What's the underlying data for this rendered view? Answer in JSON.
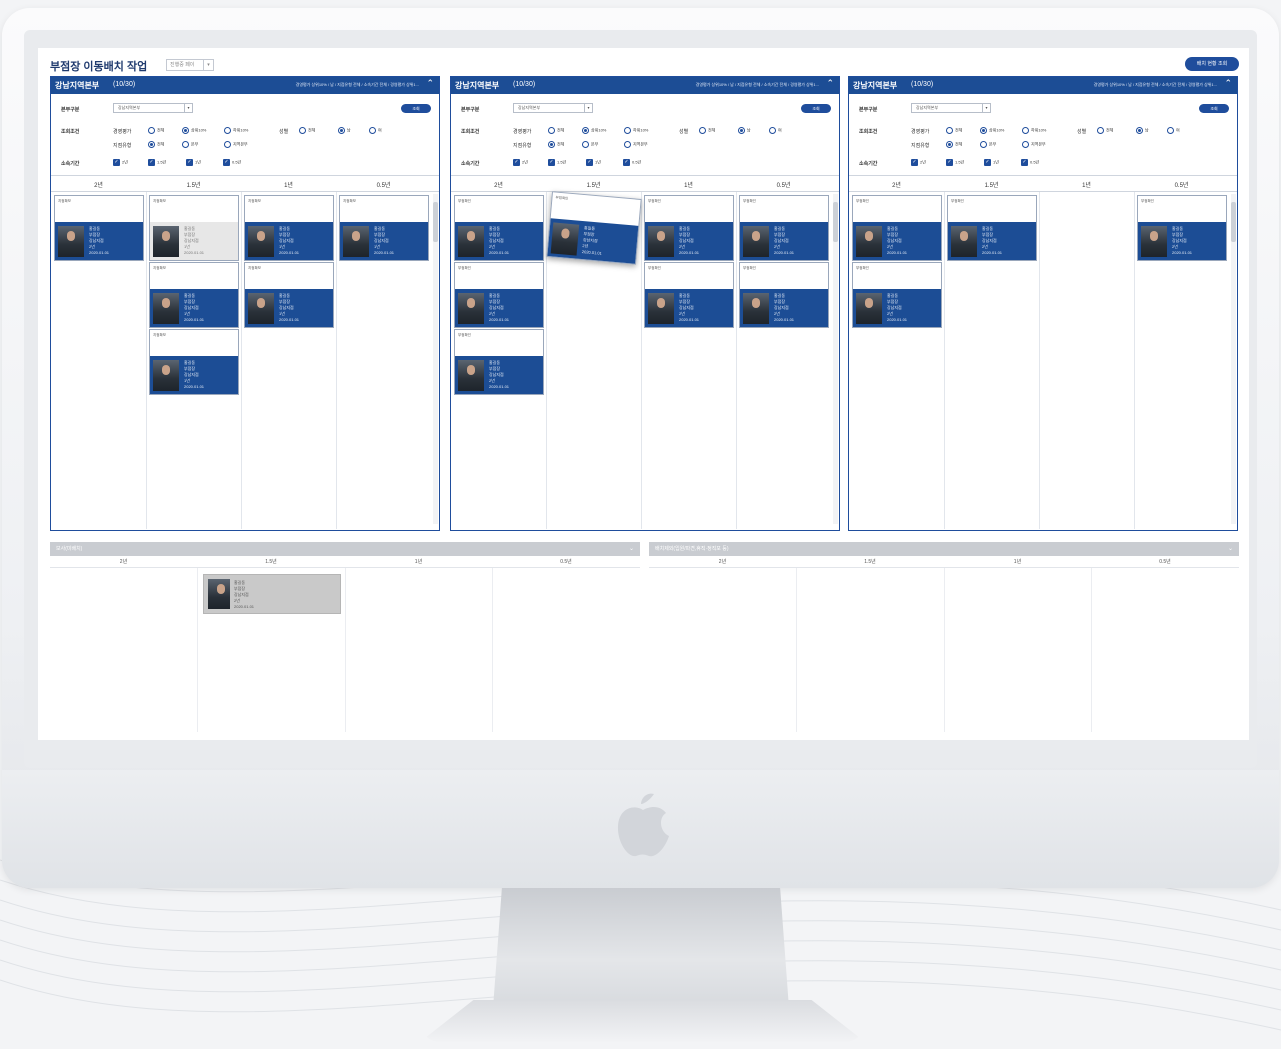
{
  "header": {
    "title": "부점장 이동배치 작업",
    "select_value": "진행중 페이",
    "select_arrow": "▾",
    "top_button": "배치 현황 조회"
  },
  "panels": [
    {
      "name": "강남지역본부",
      "count": "(10/30)",
      "summary": "경영평가 상위10% / 남 / 지점유형 전체 / 소속기간 전체 / 경영평가 상위1...",
      "caret": "⌃",
      "filters": {
        "bonbu_label": "본부구분",
        "bonbu_value": "강남지역본부",
        "search_button": "조회",
        "cond_label": "조회조건",
        "eval_label": "경영평가",
        "eval_options": [
          "전체",
          "상위10%",
          "하위10%"
        ],
        "gender_label": "성별",
        "gender_options": [
          "전체",
          "남",
          "여"
        ],
        "type_label": "지점유형",
        "type_options": [
          "전체",
          "본부",
          "지역본부"
        ],
        "period_label": "소속기간",
        "period_options": [
          "2년",
          "1.5년",
          "1년",
          "0.5년"
        ]
      },
      "columns": [
        "2년",
        "1.5년",
        "1년",
        "0.5년"
      ],
      "cards": [
        {
          "title": "지점확보",
          "name": "홍길동",
          "rank": "부점장",
          "info1": "강남지점",
          "info2": "2년",
          "info3": "2020.01.01"
        },
        {
          "title": "지점확보",
          "name": "홍길동",
          "rank": "부점장",
          "info1": "강남지점",
          "info2": "1년",
          "info3": "2020.01.01"
        },
        {
          "title": "지점확보",
          "name": "홍길동",
          "rank": "부점장",
          "info1": "강남지점",
          "info2": "1년",
          "info3": "2020.01.01"
        },
        {
          "title": "지점확보",
          "name": "홍길동",
          "rank": "부점장",
          "info1": "강남지점",
          "info2": "1년",
          "info3": "2020.01.01"
        },
        {
          "title": "지점확보",
          "name": "홍길동",
          "rank": "부점장",
          "info1": "강남지점",
          "info2": "1년",
          "info3": "2020.01.01"
        },
        {
          "title": "지점확보",
          "name": "홍길동",
          "rank": "부점장",
          "info1": "강남지점",
          "info2": "1년",
          "info3": "2020.01.01"
        },
        {
          "title": "지점확보",
          "name": "홍길동",
          "rank": "부점장",
          "info1": "강남지점",
          "info2": "1년",
          "info3": "2020.01.01"
        }
      ]
    },
    {
      "name": "강남지역본부",
      "count": "(10/30)",
      "summary": "경영평가 상위10% / 남 / 지점유형 전체 / 소속기간 전체 / 경영평가 상위1...",
      "caret": "⌃",
      "filters": {
        "bonbu_label": "본부구분",
        "bonbu_value": "강남지역본부",
        "search_button": "조회",
        "cond_label": "조회조건",
        "eval_label": "경영평가",
        "eval_options": [
          "전체",
          "상위10%",
          "하위10%"
        ],
        "gender_label": "성별",
        "gender_options": [
          "전체",
          "남",
          "여"
        ],
        "type_label": "지점유형",
        "type_options": [
          "전체",
          "본부",
          "지역본부"
        ],
        "period_label": "소속기간",
        "period_options": [
          "2년",
          "1.5년",
          "1년",
          "0.5년"
        ]
      },
      "columns": [
        "2년",
        "1.5년",
        "1년",
        "0.5년"
      ],
      "cards": [
        {
          "title": "부점확인",
          "name": "홍길동",
          "rank": "부점장",
          "info1": "강남지점",
          "info2": "2년",
          "info3": "2020.01.01"
        },
        {
          "title": "부점확인",
          "name": "홍길동",
          "rank": "부점장",
          "info1": "강남지점",
          "info2": "2년",
          "info3": "2020.01.01"
        },
        {
          "title": "부점확인",
          "name": "홍길동",
          "rank": "부점장",
          "info1": "강남지점",
          "info2": "2년",
          "info3": "2020.01.01"
        },
        {
          "title": "부점확인",
          "name": "홍길동",
          "rank": "부점장",
          "info1": "강남지점",
          "info2": "2년",
          "info3": "2020.01.01"
        },
        {
          "title": "부점확인",
          "name": "홍길동",
          "rank": "부점장",
          "info1": "강남지점",
          "info2": "2년",
          "info3": "2020.01.01"
        },
        {
          "title": "부점확인",
          "name": "홍길동",
          "rank": "부점장",
          "info1": "강남지점",
          "info2": "2년",
          "info3": "2020.01.01"
        },
        {
          "title": "부점확인",
          "name": "홍길동",
          "rank": "부점장",
          "info1": "강남지점",
          "info2": "2년",
          "info3": "2020.01.01"
        },
        {
          "title": "부점확인",
          "name": "홍길동",
          "rank": "부점장",
          "info1": "강남지점",
          "info2": "2년",
          "info3": "2020.01.01"
        }
      ]
    },
    {
      "name": "강남지역본부",
      "count": "(10/30)",
      "summary": "경영평가 상위10% / 남 / 지점유형 전체 / 소속기간 전체 / 경영평가 상위1...",
      "caret": "⌃",
      "filters": {
        "bonbu_label": "본부구분",
        "bonbu_value": "강남지역본부",
        "search_button": "조회",
        "cond_label": "조회조건",
        "eval_label": "경영평가",
        "eval_options": [
          "전체",
          "상위10%",
          "하위10%"
        ],
        "gender_label": "성별",
        "gender_options": [
          "전체",
          "남",
          "여"
        ],
        "type_label": "지점유형",
        "type_options": [
          "전체",
          "본부",
          "지역본부"
        ],
        "period_label": "소속기간",
        "period_options": [
          "2년",
          "1.5년",
          "1년",
          "0.5년"
        ]
      },
      "columns": [
        "2년",
        "1.5년",
        "1년",
        "0.5년"
      ],
      "cards": [
        {
          "title": "부점확인",
          "name": "홍길동",
          "rank": "부점장",
          "info1": "강남지점",
          "info2": "2년",
          "info3": "2020.01.01"
        },
        {
          "title": "부점확인",
          "name": "홍길동",
          "rank": "부점장",
          "info1": "강남지점",
          "info2": "2년",
          "info3": "2020.01.01"
        },
        {
          "title": "부점확인",
          "name": "홍길동",
          "rank": "부점장",
          "info1": "강남지점",
          "info2": "2년",
          "info3": "2020.01.01"
        },
        {
          "title": "부점확인",
          "name": "홍길동",
          "rank": "부점장",
          "info1": "강남지점",
          "info2": "2년",
          "info3": "2020.01.01"
        }
      ]
    }
  ],
  "pools": [
    {
      "title": "보사(미배치)",
      "caret": "⌄",
      "columns": [
        "2년",
        "1.5년",
        "1년",
        "0.5년"
      ],
      "card": {
        "name": "홍길동",
        "rank": "부점장",
        "info1": "강남지점",
        "info2": "2년",
        "info3": "2020.01.01"
      }
    },
    {
      "title": "배치제외(입원/파견,휴직·정직포 등)",
      "caret": "⌄",
      "columns": [
        "2년",
        "1.5년",
        "1년",
        "0.5년"
      ]
    }
  ],
  "colors": {
    "brand": "#1c4d95",
    "pool_header": "#c9ccd1"
  }
}
